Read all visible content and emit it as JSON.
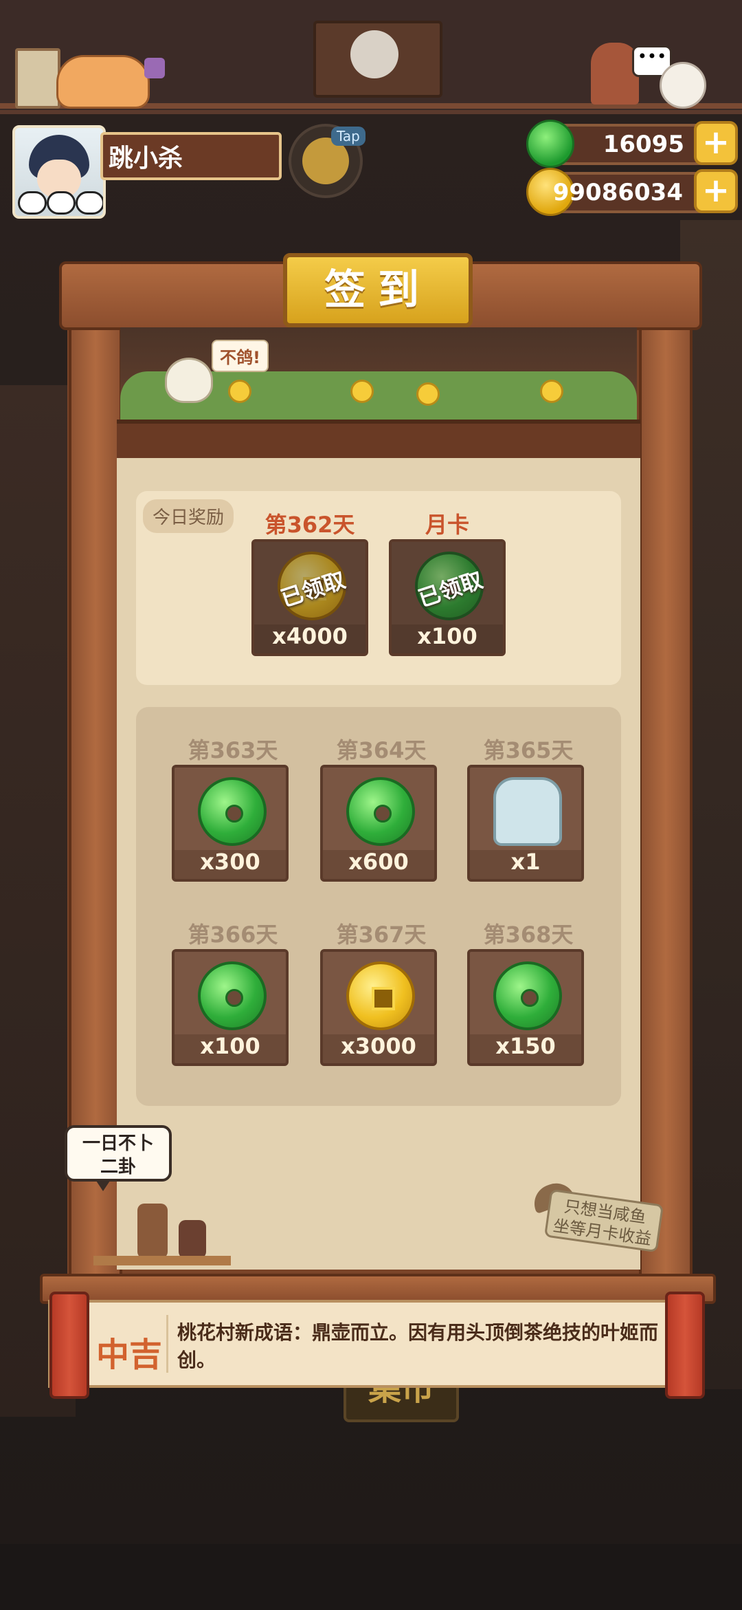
{
  "player": {
    "name": "跳小杀",
    "tap_badge": "Tap"
  },
  "currency": {
    "jade_amount": "16095",
    "coin_amount": "99086034"
  },
  "panel": {
    "title": "签到",
    "bird_bubble": "不鸽!"
  },
  "today": {
    "tag": "今日奖励",
    "rewards": [
      {
        "label": "第362天",
        "qty": "x4000",
        "type": "coin",
        "status": "已领取"
      },
      {
        "label": "月卡",
        "qty": "x100",
        "type": "jade",
        "status": "已领取"
      }
    ]
  },
  "upcoming": [
    {
      "label": "第363天",
      "qty": "x300",
      "type": "jade"
    },
    {
      "label": "第364天",
      "qty": "x600",
      "type": "jade"
    },
    {
      "label": "第365天",
      "qty": "x1",
      "type": "cake"
    },
    {
      "label": "第366天",
      "qty": "x100",
      "type": "jade"
    },
    {
      "label": "第367天",
      "qty": "x3000",
      "type": "coin"
    },
    {
      "label": "第368天",
      "qty": "x150",
      "type": "jade"
    }
  ],
  "speech": {
    "line1": "一日不卜",
    "line2": "二卦"
  },
  "sign": {
    "line1": "只想当咸鱼",
    "line2": "坐等月卡收益"
  },
  "fortune": {
    "grade": "中吉",
    "text": "桃花村新成语：鼎壶而立。因有用头顶倒茶绝技的叶姬而创。"
  },
  "background": {
    "market_label": "集市"
  },
  "colors": {
    "accent_gold": "#f3c23a",
    "today_label": "#c9542c",
    "future_label": "#a48c73",
    "wood": "#8e5232"
  }
}
